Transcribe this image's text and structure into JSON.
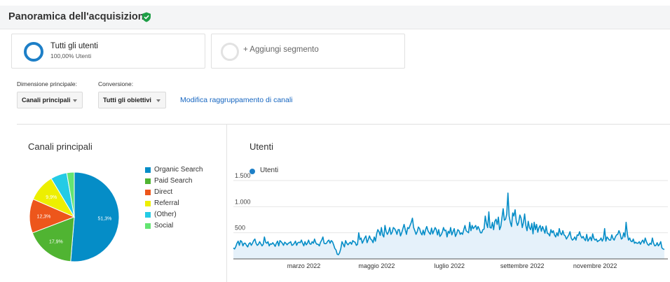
{
  "header": {
    "title": "Panoramica dell'acquisizione",
    "verified_icon": "shield-check-icon"
  },
  "segments": [
    {
      "name": "Tutti gli utenti",
      "sub": "100,00% Utenti"
    },
    {
      "add_label": "+ Aggiungi segmento"
    }
  ],
  "controls": {
    "dimension_label": "Dimensione principale:",
    "dimension_value": "Canali principali",
    "conversion_label": "Conversione:",
    "conversion_value": "Tutti gli obiettivi",
    "edit_link": "Modifica raggruppamento di canali"
  },
  "colors": {
    "accent": "#1d7fc7",
    "link": "#1565c0"
  },
  "chart_data": [
    {
      "type": "pie",
      "title": "Canali principali",
      "slices": [
        {
          "label": "Organic Search",
          "value": 51.3,
          "display": "51,3%",
          "color": "#058dc7"
        },
        {
          "label": "Paid Search",
          "value": 17.9,
          "display": "17,9%",
          "color": "#50b432"
        },
        {
          "label": "Direct",
          "value": 12.3,
          "display": "12,3%",
          "color": "#ed561b"
        },
        {
          "label": "Referral",
          "value": 9.9,
          "display": "9,9%",
          "color": "#edef00"
        },
        {
          "label": "(Other)",
          "value": 5.9,
          "display": "",
          "color": "#24cbe5"
        },
        {
          "label": "Social",
          "value": 2.7,
          "display": "",
          "color": "#64e572"
        }
      ]
    },
    {
      "type": "area",
      "title": "Utenti",
      "series": [
        {
          "name": "Utenti",
          "color": "#058dc7"
        }
      ],
      "yticks": [
        "1.500",
        "1.000",
        "500"
      ],
      "ytick_values": [
        1500,
        1000,
        500
      ],
      "ylim": [
        0,
        1500
      ],
      "xticks": [
        "marzo 2022",
        "maggio 2022",
        "luglio 2022",
        "settembre 2022",
        "novembre 2022"
      ],
      "xtick_pos": [
        59,
        120,
        181,
        242,
        303
      ],
      "num_days": 365,
      "values": [
        210,
        190,
        235,
        300,
        340,
        260,
        350,
        330,
        250,
        300,
        300,
        260,
        230,
        290,
        310,
        260,
        300,
        350,
        380,
        300,
        260,
        280,
        330,
        290,
        250,
        280,
        420,
        320,
        300,
        330,
        250,
        290,
        280,
        310,
        280,
        240,
        300,
        340,
        250,
        350,
        330,
        300,
        260,
        320,
        300,
        270,
        300,
        310,
        330,
        260,
        270,
        300,
        340,
        260,
        310,
        320,
        310,
        360,
        300,
        250,
        330,
        270,
        300,
        360,
        290,
        280,
        330,
        300,
        380,
        310,
        280,
        280,
        250,
        320,
        360,
        420,
        300,
        290,
        300,
        340,
        360,
        300,
        350,
        330,
        270,
        200,
        170,
        90,
        80,
        120,
        200,
        330,
        280,
        230,
        350,
        300,
        270,
        300,
        320,
        280,
        350,
        330,
        320,
        260,
        280,
        500,
        370,
        400,
        300,
        350,
        400,
        440,
        310,
        370,
        440,
        380,
        360,
        310,
        420,
        340,
        480,
        560,
        520,
        450,
        600,
        460,
        420,
        640,
        520,
        470,
        520,
        600,
        470,
        510,
        600,
        580,
        540,
        470,
        560,
        560,
        440,
        500,
        580,
        660,
        560,
        470,
        600,
        580,
        640,
        700,
        780,
        600,
        540,
        470,
        520,
        610,
        580,
        500,
        460,
        550,
        460,
        560,
        620,
        540,
        500,
        470,
        590,
        480,
        540,
        600,
        560,
        460,
        560,
        430,
        460,
        510,
        600,
        540,
        550,
        420,
        530,
        490,
        600,
        460,
        520,
        580,
        430,
        480,
        560,
        540,
        470,
        500,
        470,
        560,
        640,
        540,
        520,
        500,
        700,
        540,
        640,
        580,
        610,
        640,
        560,
        620,
        570,
        500,
        500,
        560,
        570,
        820,
        680,
        600,
        900,
        600,
        590,
        700,
        560,
        720,
        760,
        660,
        800,
        560,
        620,
        790,
        960,
        740,
        760,
        860,
        1260,
        820,
        700,
        620,
        880,
        820,
        940,
        720,
        640,
        700,
        840,
        780,
        600,
        700,
        860,
        640,
        540,
        720,
        600,
        560,
        680,
        480,
        700,
        560,
        660,
        510,
        600,
        640,
        530,
        620,
        560,
        490,
        630,
        490,
        480,
        440,
        560,
        500,
        540,
        460,
        420,
        500,
        440,
        580,
        490,
        460,
        540,
        460,
        440,
        380,
        420,
        460,
        520,
        400,
        360,
        380,
        420,
        360,
        460,
        450,
        520,
        440,
        400,
        430,
        380,
        350,
        470,
        340,
        380,
        420,
        350,
        480,
        390,
        360,
        380,
        330,
        350,
        360,
        400,
        340,
        390,
        580,
        340,
        420,
        390,
        360,
        360,
        460,
        390,
        360,
        420,
        460,
        470,
        540,
        480,
        380,
        400,
        500,
        420,
        700,
        480,
        360,
        400,
        340,
        330,
        380,
        300,
        320,
        300,
        300,
        330,
        280,
        330,
        360,
        300,
        400,
        330,
        280,
        260,
        300,
        280,
        400,
        300,
        250,
        260,
        310,
        250,
        280,
        330,
        210,
        190,
        180
      ]
    }
  ]
}
